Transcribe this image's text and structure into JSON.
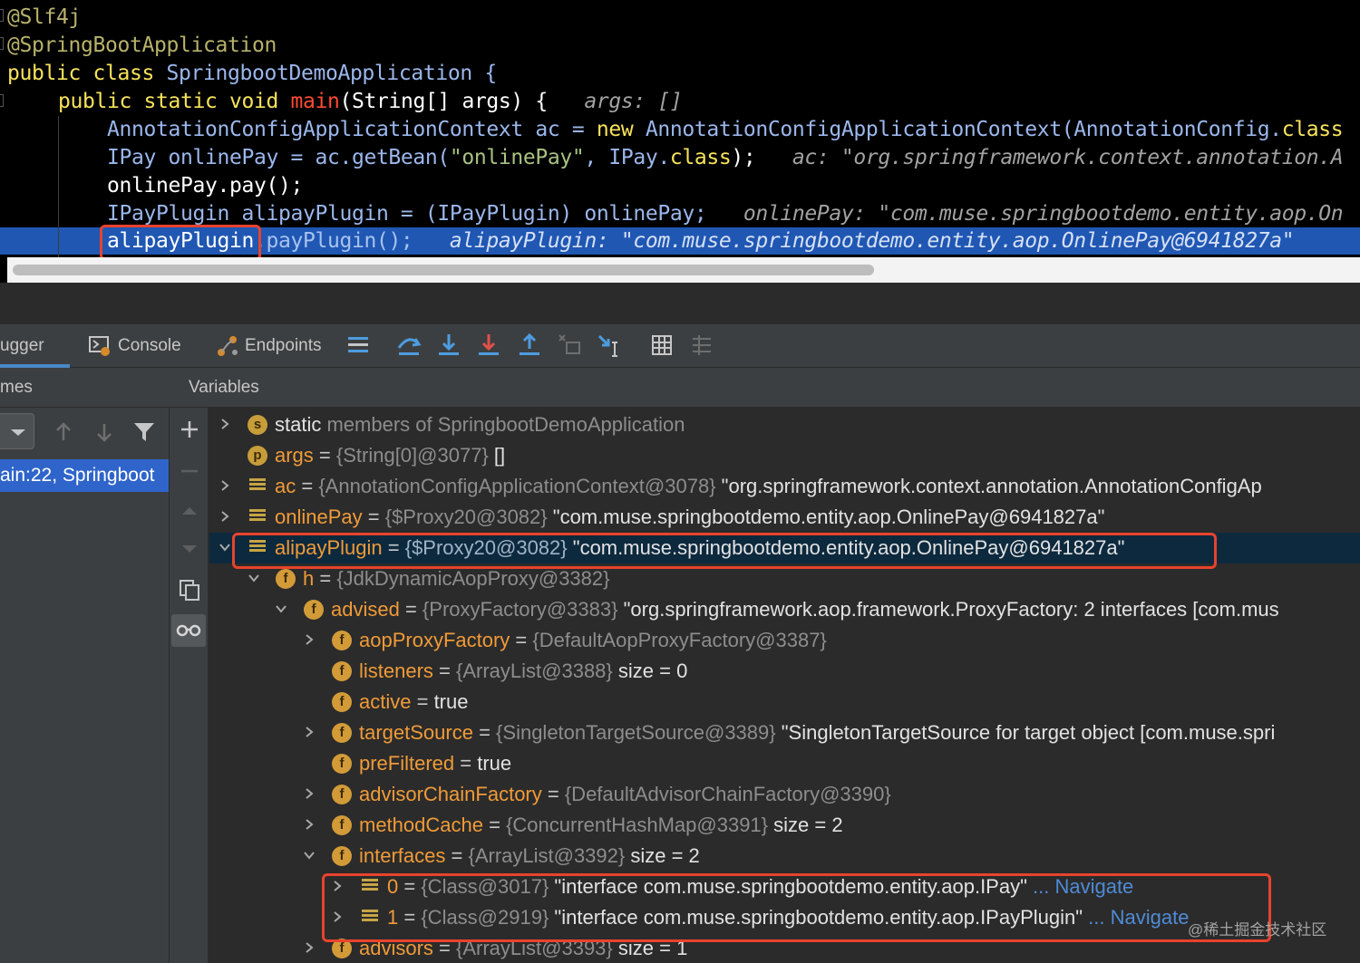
{
  "editor": {
    "lines": [
      [
        "@Slf4j"
      ],
      [
        "@SpringBootApplication"
      ],
      [
        "public",
        " ",
        "class",
        " SpringbootDemoApplication {"
      ],
      [
        "public",
        " ",
        "static",
        " ",
        "void",
        " ",
        "main",
        "(String[] args) {",
        "   args: []"
      ],
      [
        "AnnotationConfigApplicationContext ac = ",
        "new",
        " AnnotationConfigApplicationContext(AnnotationConfig.",
        "class"
      ],
      [
        "IPay onlinePay = ac.getBean(",
        "\"onlinePay\"",
        ", IPay.",
        "class",
        ");",
        "   ac: \"org.springframework.context.annotation.A"
      ],
      [
        "onlinePay.pay();"
      ],
      [
        "IPayPlugin alipayPlugin = (IPayPlugin) onlinePay;",
        "   onlinePay: \"com.muse.springbootdemo.entity.aop.On"
      ],
      [
        "alipayPlugin",
        ".payPlugin();",
        "   alipayPlugin: \"com.muse.springbootdemo.entity.aop.OnlinePay@6941827a\""
      ]
    ]
  },
  "toolbar": {
    "tab_debugger": "ugger",
    "tab_console": "Console",
    "tab_endpoints": "Endpoints"
  },
  "frames": {
    "header": "mes",
    "selected_frame": "ain:22, Springboot"
  },
  "variables": {
    "header": "Variables",
    "rows": [
      {
        "name": "static",
        "type": " members of SpringbootDemoApplication",
        "value": ""
      },
      {
        "name": "args",
        "eq": " = ",
        "type": "{String[0]@3077}",
        "value": " []"
      },
      {
        "name": "ac",
        "eq": " = ",
        "type": "{AnnotationConfigApplicationContext@3078}",
        "value": " \"org.springframework.context.annotation.AnnotationConfigAp"
      },
      {
        "name": "onlinePay",
        "eq": " = ",
        "type": "{$Proxy20@3082}",
        "value": " \"com.muse.springbootdemo.entity.aop.OnlinePay@6941827a\""
      },
      {
        "name": "alipayPlugin",
        "eq": " = ",
        "type": "{$Proxy20@3082}",
        "value": " \"com.muse.springbootdemo.entity.aop.OnlinePay@6941827a\""
      },
      {
        "name": "h",
        "eq": " = ",
        "type": "{JdkDynamicAopProxy@3382}",
        "value": ""
      },
      {
        "name": "advised",
        "eq": " = ",
        "type": "{ProxyFactory@3383}",
        "value": " \"org.springframework.aop.framework.ProxyFactory: 2 interfaces [com.mus"
      },
      {
        "name": "aopProxyFactory",
        "eq": " = ",
        "type": "{DefaultAopProxyFactory@3387}",
        "value": ""
      },
      {
        "name": "listeners",
        "eq": " = ",
        "type": "{ArrayList@3388}",
        "value": "  size = 0"
      },
      {
        "name": "active",
        "eq": " = ",
        "type": "",
        "value": "true"
      },
      {
        "name": "targetSource",
        "eq": " = ",
        "type": "{SingletonTargetSource@3389}",
        "value": " \"SingletonTargetSource for target object [com.muse.spri"
      },
      {
        "name": "preFiltered",
        "eq": " = ",
        "type": "",
        "value": "true"
      },
      {
        "name": "advisorChainFactory",
        "eq": " = ",
        "type": "{DefaultAdvisorChainFactory@3390}",
        "value": ""
      },
      {
        "name": "methodCache",
        "eq": " = ",
        "type": "{ConcurrentHashMap@3391}",
        "value": "  size = 2"
      },
      {
        "name": "interfaces",
        "eq": " = ",
        "type": "{ArrayList@3392}",
        "value": "  size = 2"
      },
      {
        "name": "0",
        "eq": " = ",
        "type": "{Class@3017}",
        "value": " \"interface com.muse.springbootdemo.entity.aop.IPay\"",
        "nav": " ... Navigate"
      },
      {
        "name": "1",
        "eq": " = ",
        "type": "{Class@2919}",
        "value": " \"interface com.muse.springbootdemo.entity.aop.IPayPlugin\"",
        "nav": " ... Navigate"
      },
      {
        "name": "advisors",
        "eq": " = ",
        "type": "{ArrayList@3393}",
        "value": "  size = 1"
      }
    ]
  },
  "watermark": "@稀土掘金技术社区",
  "colors": {
    "accent_highlight": "#1f57b3",
    "selection_row": "#0d293e",
    "annotation_box": "#e8432d",
    "variable_name": "#f09b38"
  }
}
